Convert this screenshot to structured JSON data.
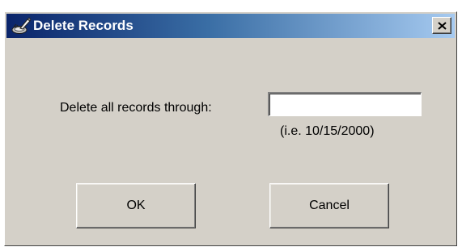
{
  "window": {
    "title": "Delete Records",
    "title_icon": "delete-records-app-icon",
    "close_icon": "close-icon",
    "close_label": "Close"
  },
  "form": {
    "label": "Delete all records through:",
    "date_value": "",
    "hint": "(i.e. 10/15/2000)"
  },
  "buttons": {
    "ok_label": "OK",
    "cancel_label": "Cancel"
  },
  "colors": {
    "dialog_face": "#d4d0c8",
    "titlebar_start": "#0a246a",
    "titlebar_end": "#a6caf0",
    "title_text": "#ffffff"
  }
}
